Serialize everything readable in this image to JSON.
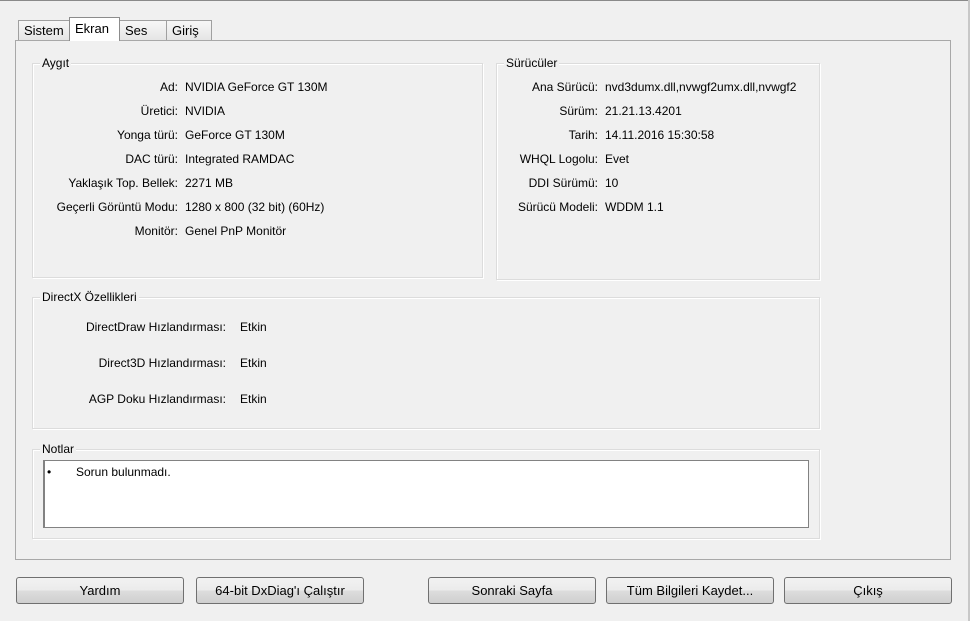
{
  "tabs": [
    {
      "label": "Sistem"
    },
    {
      "label": "Ekran"
    },
    {
      "label": "Ses"
    },
    {
      "label": "Giriş"
    }
  ],
  "device": {
    "title": "Aygıt",
    "rows": [
      {
        "label": "Ad:",
        "value": "NVIDIA GeForce GT 130M"
      },
      {
        "label": "Üretici:",
        "value": "NVIDIA"
      },
      {
        "label": "Yonga türü:",
        "value": "GeForce GT 130M"
      },
      {
        "label": "DAC türü:",
        "value": "Integrated RAMDAC"
      },
      {
        "label": "Yaklaşık Top. Bellek:",
        "value": "2271 MB"
      },
      {
        "label": "Geçerli Görüntü Modu:",
        "value": "1280 x 800 (32 bit) (60Hz)"
      },
      {
        "label": "Monitör:",
        "value": "Genel PnP Monitör"
      }
    ]
  },
  "drivers": {
    "title": "Sürücüler",
    "rows": [
      {
        "label": "Ana Sürücü:",
        "value": "nvd3dumx.dll,nvwgf2umx.dll,nvwgf2"
      },
      {
        "label": "Sürüm:",
        "value": "21.21.13.4201"
      },
      {
        "label": "Tarih:",
        "value": "14.11.2016 15:30:58"
      },
      {
        "label": "WHQL Logolu:",
        "value": "Evet"
      },
      {
        "label": "DDI Sürümü:",
        "value": "10"
      },
      {
        "label": "Sürücü Modeli:",
        "value": "WDDM 1.1"
      }
    ]
  },
  "directx": {
    "title": "DirectX Özellikleri",
    "rows": [
      {
        "label": "DirectDraw Hızlandırması:",
        "value": "Etkin"
      },
      {
        "label": "Direct3D Hızlandırması:",
        "value": "Etkin"
      },
      {
        "label": "AGP Doku Hızlandırması:",
        "value": "Etkin"
      }
    ]
  },
  "notes": {
    "title": "Notlar",
    "bullet": "•",
    "items": [
      "Sorun bulunmadı."
    ]
  },
  "buttons": {
    "help": "Yardım",
    "run64": "64-bit DxDiag'ı Çalıştır",
    "next": "Sonraki Sayfa",
    "save_all": "Tüm Bilgileri Kaydet...",
    "exit": "Çıkış"
  }
}
